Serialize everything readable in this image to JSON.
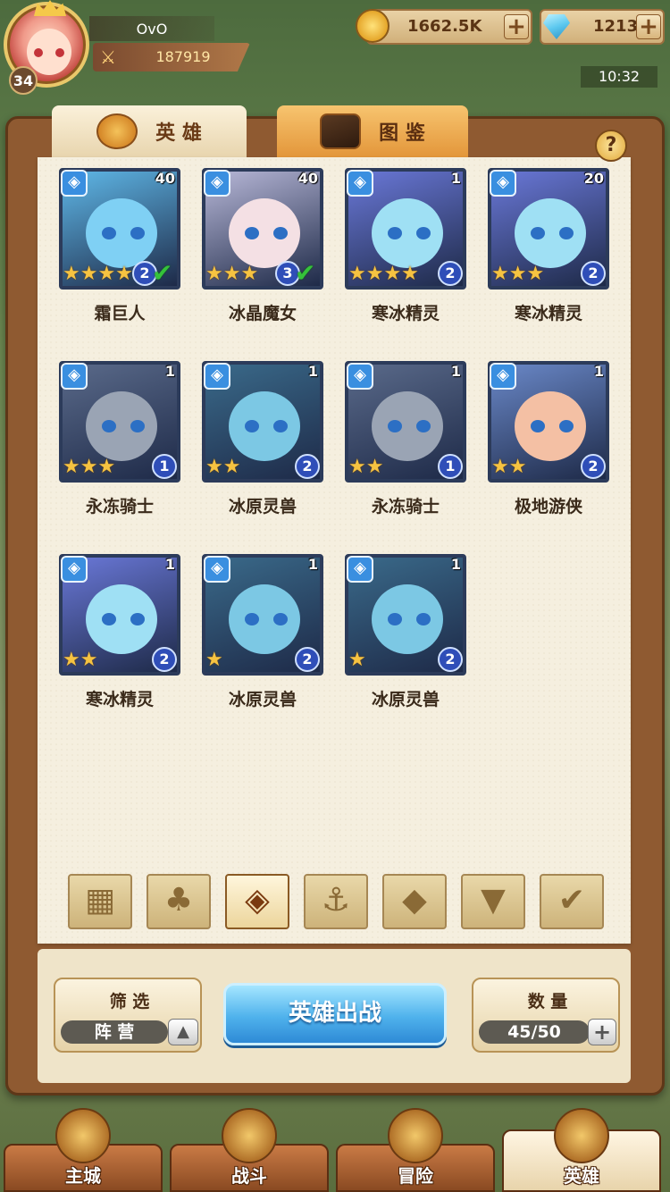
{
  "player": {
    "name": "OvO",
    "level": "34",
    "power": "187919"
  },
  "resources": {
    "gold": {
      "value": "1662.5K",
      "plus": "+"
    },
    "gems": {
      "value": "1213",
      "plus": "+"
    }
  },
  "status": {
    "time": "10:32"
  },
  "tabs": [
    {
      "label": "英 雄"
    },
    {
      "label": "图 鉴"
    }
  ],
  "help": {
    "label": "?"
  },
  "heroes": [
    {
      "name": "霜巨人",
      "level": "40",
      "stars": 4,
      "star_text": "★★★★",
      "rank": "2",
      "deployed": true,
      "color": "#5fb8e8",
      "head": "#7fd0f4"
    },
    {
      "name": "冰晶魔女",
      "level": "40",
      "stars": 3,
      "star_text": "★★★",
      "rank": "3",
      "deployed": true,
      "color": "#b8b8d8",
      "head": "#f4e0e4"
    },
    {
      "name": "寒冰精灵",
      "level": "1",
      "stars": 4,
      "star_text": "★★★★",
      "rank": "2",
      "deployed": false,
      "color": "#6a78d8",
      "head": "#9fe0f4"
    },
    {
      "name": "寒冰精灵",
      "level": "20",
      "stars": 3,
      "star_text": "★★★",
      "rank": "2",
      "deployed": false,
      "color": "#6a78d8",
      "head": "#9fe0f4"
    },
    {
      "name": "永冻骑士",
      "level": "1",
      "stars": 3,
      "star_text": "★★★",
      "rank": "1",
      "deployed": false,
      "color": "#5a6a8a",
      "head": "#9aa4b4"
    },
    {
      "name": "冰原灵兽",
      "level": "1",
      "stars": 2,
      "star_text": "★★",
      "rank": "2",
      "deployed": false,
      "color": "#3a6a8a",
      "head": "#7cc8e4"
    },
    {
      "name": "永冻骑士",
      "level": "1",
      "stars": 2,
      "star_text": "★★",
      "rank": "1",
      "deployed": false,
      "color": "#5a6a8a",
      "head": "#9aa4b4"
    },
    {
      "name": "极地游侠",
      "level": "1",
      "stars": 2,
      "star_text": "★★",
      "rank": "2",
      "deployed": false,
      "color": "#6a88c8",
      "head": "#f4c0a4"
    },
    {
      "name": "寒冰精灵",
      "level": "1",
      "stars": 2,
      "star_text": "★★",
      "rank": "2",
      "deployed": false,
      "color": "#6a78d8",
      "head": "#9fe0f4"
    },
    {
      "name": "冰原灵兽",
      "level": "1",
      "stars": 1,
      "star_text": "★",
      "rank": "2",
      "deployed": false,
      "color": "#3a6a8a",
      "head": "#7cc8e4"
    },
    {
      "name": "冰原灵兽",
      "level": "1",
      "stars": 1,
      "star_text": "★",
      "rank": "2",
      "deployed": false,
      "color": "#3a6a8a",
      "head": "#7cc8e4"
    }
  ],
  "filters": [
    {
      "icon": "grid-icon",
      "glyph": "▦",
      "active": false
    },
    {
      "icon": "forest-faction-icon",
      "glyph": "♣",
      "active": false
    },
    {
      "icon": "ice-faction-icon",
      "glyph": "◈",
      "active": true
    },
    {
      "icon": "anchor-faction-icon",
      "glyph": "⚓",
      "active": false
    },
    {
      "icon": "beast-faction-icon",
      "glyph": "◆",
      "active": false
    },
    {
      "icon": "demon-faction-icon",
      "glyph": "▼",
      "active": false
    },
    {
      "icon": "wing-faction-icon",
      "glyph": "✔",
      "active": false
    }
  ],
  "controls": {
    "filter_label": "筛 选",
    "filter_value": "阵 营",
    "deploy_label": "英雄出战",
    "count_label": "数 量",
    "count_value": "45/50",
    "plus": "+"
  },
  "nav": [
    {
      "label": "主城",
      "active": false
    },
    {
      "label": "战斗",
      "active": false
    },
    {
      "label": "冒险",
      "active": false
    },
    {
      "label": "英雄",
      "active": true
    }
  ]
}
